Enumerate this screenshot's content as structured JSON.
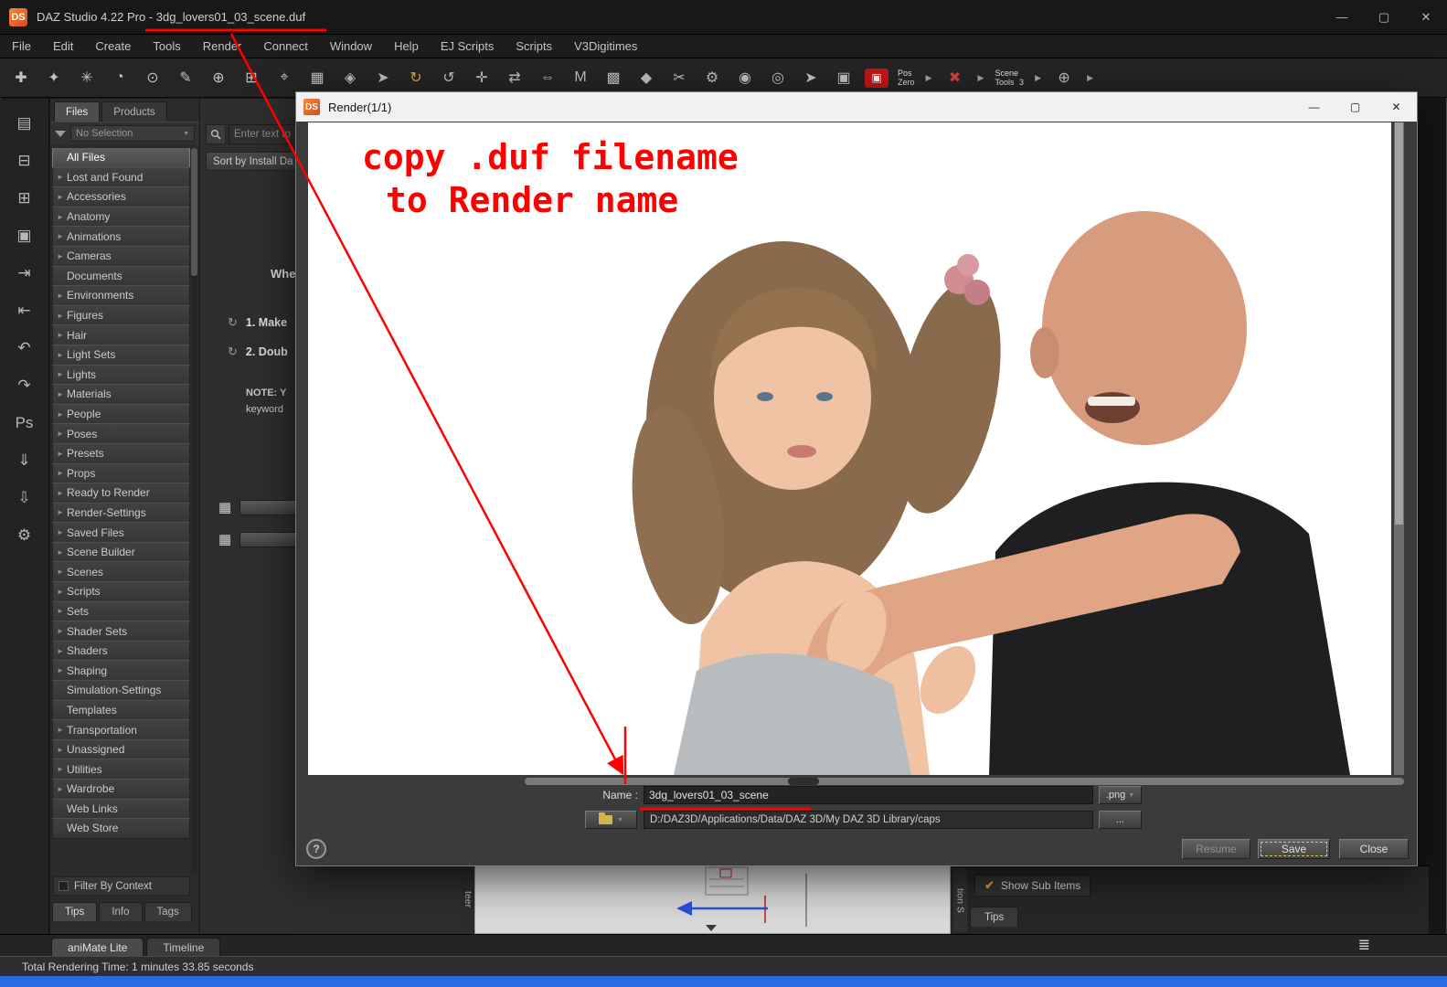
{
  "colors": {
    "annotation_red": "#ff0000",
    "logo_orange": "#e8611c",
    "taskbar_blue": "#2a6be2",
    "check_orange": "#e09a3a",
    "save_focus_yellow": "#d8c75a"
  },
  "ui": {
    "dropdown_arrow": "▼",
    "tree_arrow": "►"
  },
  "titlebar": {
    "logo": "DS",
    "title": "DAZ Studio 4.22 Pro - 3dg_lovers01_03_scene.duf",
    "minimize": "—",
    "maximize": "▢",
    "close": "✕"
  },
  "menubar": {
    "items": [
      "File",
      "Edit",
      "Create",
      "Tools",
      "Render",
      "Connect",
      "Window",
      "Help",
      "EJ Scripts",
      "Scripts",
      "V3Digitimes"
    ]
  },
  "left_strip": {
    "icons": [
      {
        "name": "new-file-icon",
        "glyph": "▤"
      },
      {
        "name": "open-file-icon",
        "glyph": "⊟"
      },
      {
        "name": "merge-file-icon",
        "glyph": "⊞"
      },
      {
        "name": "save-file-icon",
        "glyph": "▣"
      },
      {
        "name": "import-icon",
        "glyph": "⇥"
      },
      {
        "name": "export-icon",
        "glyph": "⇤"
      },
      {
        "name": "undo-icon",
        "glyph": "↶"
      },
      {
        "name": "redo-icon",
        "glyph": "↷"
      },
      {
        "name": "photoshop-bridge-icon",
        "glyph": "Ps"
      },
      {
        "name": "download-manager-icon",
        "glyph": "⇓"
      },
      {
        "name": "install-manager-icon",
        "glyph": "⇩"
      },
      {
        "name": "customize-tools-icon",
        "glyph": "⚙"
      }
    ]
  },
  "toolbar": {
    "items": [
      {
        "name": "create-new-node-icon",
        "glyph": "✚"
      },
      {
        "name": "powerpose-icon",
        "glyph": "✦"
      },
      {
        "name": "surface-brush-icon",
        "glyph": "✳"
      },
      {
        "name": "pose-timer-icon",
        "glyph": "◔"
      },
      {
        "name": "spot-render-icon",
        "glyph": "⊙"
      },
      {
        "name": "annotate-icon",
        "glyph": "✎"
      },
      {
        "name": "group-node-icon",
        "glyph": "⊕"
      },
      {
        "name": "aux-viewport-icon",
        "glyph": "⊞"
      },
      {
        "name": "aim-target-icon",
        "glyph": "⌖"
      },
      {
        "name": "grid-view-icon",
        "glyph": "▦"
      },
      {
        "name": "selection-cube-icon",
        "glyph": "◈"
      },
      {
        "name": "pointer-tool-icon",
        "glyph": "➤"
      },
      {
        "name": "rotate-tool-active-icon",
        "glyph": "↻",
        "color": "#e8a33d"
      },
      {
        "name": "rotate-tool-icon",
        "glyph": "↺"
      },
      {
        "name": "translate-tool-icon",
        "glyph": "✛"
      },
      {
        "name": "node-swap-icon",
        "glyph": "⇄"
      },
      {
        "name": "scale-tool-icon",
        "glyph": "⇔"
      },
      {
        "name": "measure-tool-icon",
        "glyph": "M"
      },
      {
        "name": "geometry-editor-icon",
        "glyph": "▩"
      },
      {
        "name": "figure-paint-icon",
        "glyph": "◆"
      },
      {
        "name": "cutout-tool-icon",
        "glyph": "✂"
      },
      {
        "name": "multi-tool-icon",
        "glyph": "⚙"
      },
      {
        "name": "rigging-tool-icon",
        "glyph": "◉"
      },
      {
        "name": "key-tool-icon",
        "glyph": "◎"
      },
      {
        "name": "node-pointer-icon",
        "glyph": "➤"
      },
      {
        "name": "camera-icon",
        "glyph": "▣"
      },
      {
        "name": "render-camera-icon",
        "glyph": "▣",
        "red": true
      },
      {
        "name": "pos-zero-button",
        "text": "Pos\nZero"
      },
      {
        "name": "flyout-arrow-icon",
        "glyph": "▶",
        "small": true
      },
      {
        "name": "clear-figure-icon",
        "glyph": "✖",
        "color": "#d54040"
      },
      {
        "name": "flyout-arrow-icon",
        "glyph": "▶",
        "small": true
      },
      {
        "name": "scene-tools-button",
        "text": "Scene\nTools",
        "num": "3"
      },
      {
        "name": "flyout-arrow-icon",
        "glyph": "▶",
        "small": true
      },
      {
        "name": "orb-widget-icon",
        "glyph": "⊕"
      },
      {
        "name": "flyout-arrow-icon",
        "glyph": "▶",
        "small": true
      }
    ]
  },
  "content_library": {
    "tabs": [
      {
        "label": "Files",
        "active": true
      },
      {
        "label": "Products",
        "active": false
      }
    ],
    "filter_value": "No Selection",
    "tree": [
      {
        "label": "All Files",
        "arrow": false,
        "selected": true
      },
      {
        "label": "Lost and Found",
        "arrow": true
      },
      {
        "label": "Accessories",
        "arrow": true
      },
      {
        "label": "Anatomy",
        "arrow": true
      },
      {
        "label": "Animations",
        "arrow": true
      },
      {
        "label": "Cameras",
        "arrow": true
      },
      {
        "label": "Documents",
        "arrow": false
      },
      {
        "label": "Environments",
        "arrow": true
      },
      {
        "label": "Figures",
        "arrow": true
      },
      {
        "label": "Hair",
        "arrow": true
      },
      {
        "label": "Light Sets",
        "arrow": true
      },
      {
        "label": "Lights",
        "arrow": true
      },
      {
        "label": "Materials",
        "arrow": true
      },
      {
        "label": "People",
        "arrow": true
      },
      {
        "label": "Poses",
        "arrow": true
      },
      {
        "label": "Presets",
        "arrow": true
      },
      {
        "label": "Props",
        "arrow": true
      },
      {
        "label": "Ready to Render",
        "arrow": true
      },
      {
        "label": "Render-Settings",
        "arrow": true
      },
      {
        "label": "Saved Files",
        "arrow": true
      },
      {
        "label": "Scene Builder",
        "arrow": true
      },
      {
        "label": "Scenes",
        "arrow": true
      },
      {
        "label": "Scripts",
        "arrow": true
      },
      {
        "label": "Sets",
        "arrow": true
      },
      {
        "label": "Shader Sets",
        "arrow": true
      },
      {
        "label": "Shaders",
        "arrow": true
      },
      {
        "label": "Shaping",
        "arrow": true
      },
      {
        "label": "Simulation-Settings",
        "arrow": false
      },
      {
        "label": "Templates",
        "arrow": false
      },
      {
        "label": "Transportation",
        "arrow": true
      },
      {
        "label": "Unassigned",
        "arrow": true
      },
      {
        "label": "Utilities",
        "arrow": true
      },
      {
        "label": "Wardrobe",
        "arrow": true
      },
      {
        "label": "Web Links",
        "arrow": false
      },
      {
        "label": "Web Store",
        "arrow": false
      }
    ],
    "filter_by_context_label": "Filter By Context",
    "bottom_tabs": [
      "Tips",
      "Info",
      "Tags"
    ]
  },
  "smart_pane": {
    "search_placeholder": "Enter text to",
    "sort_label": "Sort by Install Da",
    "heading_partial": "Whe",
    "step1_partial": "1. Make",
    "step2_partial": "2. Doub",
    "note_partial_1": "NOTE: Y",
    "note_partial_2": "keyword"
  },
  "render_dialog": {
    "logo": "DS",
    "title": "Render(1/1)",
    "minimize": "—",
    "maximize": "▢",
    "close": "✕",
    "name_label": "Name :",
    "name_value": "3dg_lovers01_03_scene",
    "format_value": ".png",
    "path_value": "D:/DAZ3D/Applications/Data/DAZ 3D/My DAZ 3D Library/caps",
    "browse_label": "...",
    "help_label": "?",
    "resume_label": "Resume",
    "save_label": "Save",
    "close_label": "Close"
  },
  "annotation": {
    "line1": "copy .duf filename",
    "line2": "to Render name"
  },
  "bottom_right_pane": {
    "show_sub_items_label": "Show Sub Items",
    "check_glyph": "✔",
    "tips_tab": "Tips",
    "vertical_tab_left": "teer",
    "vertical_tab_right": "tion S"
  },
  "bottom_bars": {
    "animate_tab": "aniMate Lite",
    "timeline_tab": "Timeline",
    "status_text": "Total Rendering Time: 1 minutes 33.85 seconds",
    "notes_icon_glyph": "≣"
  }
}
